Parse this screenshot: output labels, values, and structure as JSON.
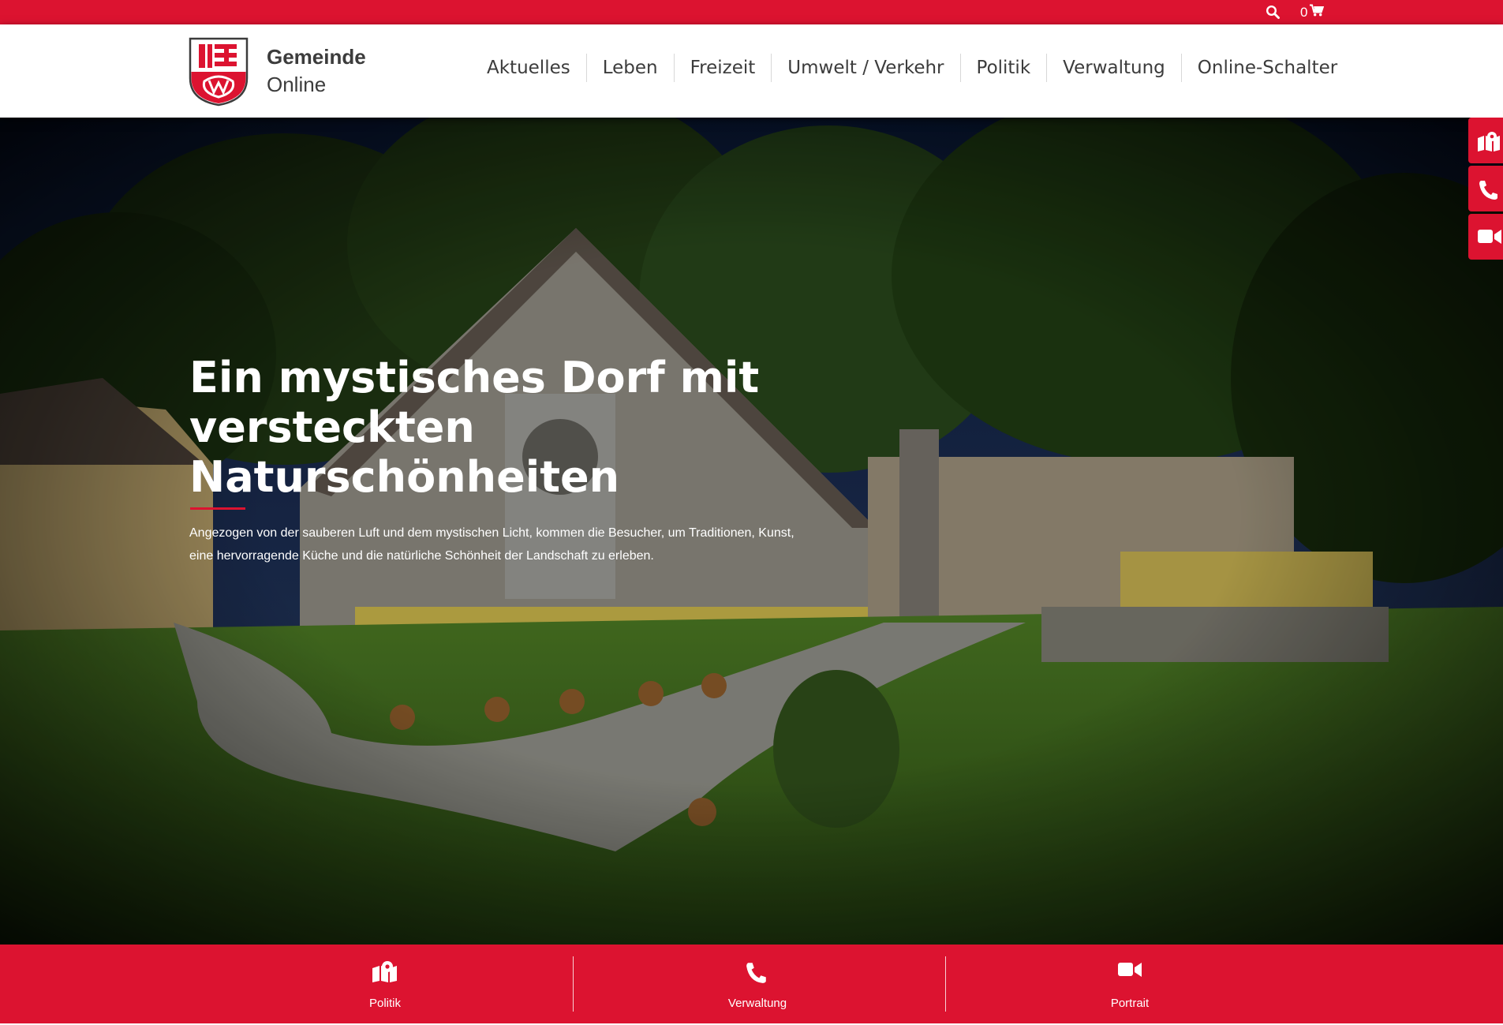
{
  "topbar": {
    "search_icon": "search-icon",
    "cart_count": "0",
    "cart_icon": "cart-icon"
  },
  "brand": {
    "name_line1": "Gemeinde",
    "name_line2": "Online",
    "logo_icon": "coat-of-arms-icon"
  },
  "nav": {
    "items": [
      "Aktuelles",
      "Leben",
      "Freizeit",
      "Umwelt / Verkehr",
      "Politik",
      "Verwaltung",
      "Online-Schalter"
    ]
  },
  "hero": {
    "title": "Ein mystisches Dorf mit versteckten Naturschönheiten",
    "text": "Angezogen von der sauberen Luft und dem mystischen Licht, kommen die Besucher, um Traditionen, Kunst, eine hervorragende Küche und die natürliche Schönheit der Landschaft zu erleben.",
    "image_icon": "village-photo"
  },
  "side_buttons": [
    "map-marker-icon",
    "phone-icon",
    "video-icon"
  ],
  "bottom": {
    "items": [
      {
        "label": "Politik",
        "icon": "map-marker-icon"
      },
      {
        "label": "Verwaltung",
        "icon": "phone-icon"
      },
      {
        "label": "Portrait",
        "icon": "video-icon"
      }
    ]
  },
  "colors": {
    "accent": "#dc1330",
    "text": "#3c3c3c",
    "white": "#ffffff"
  }
}
